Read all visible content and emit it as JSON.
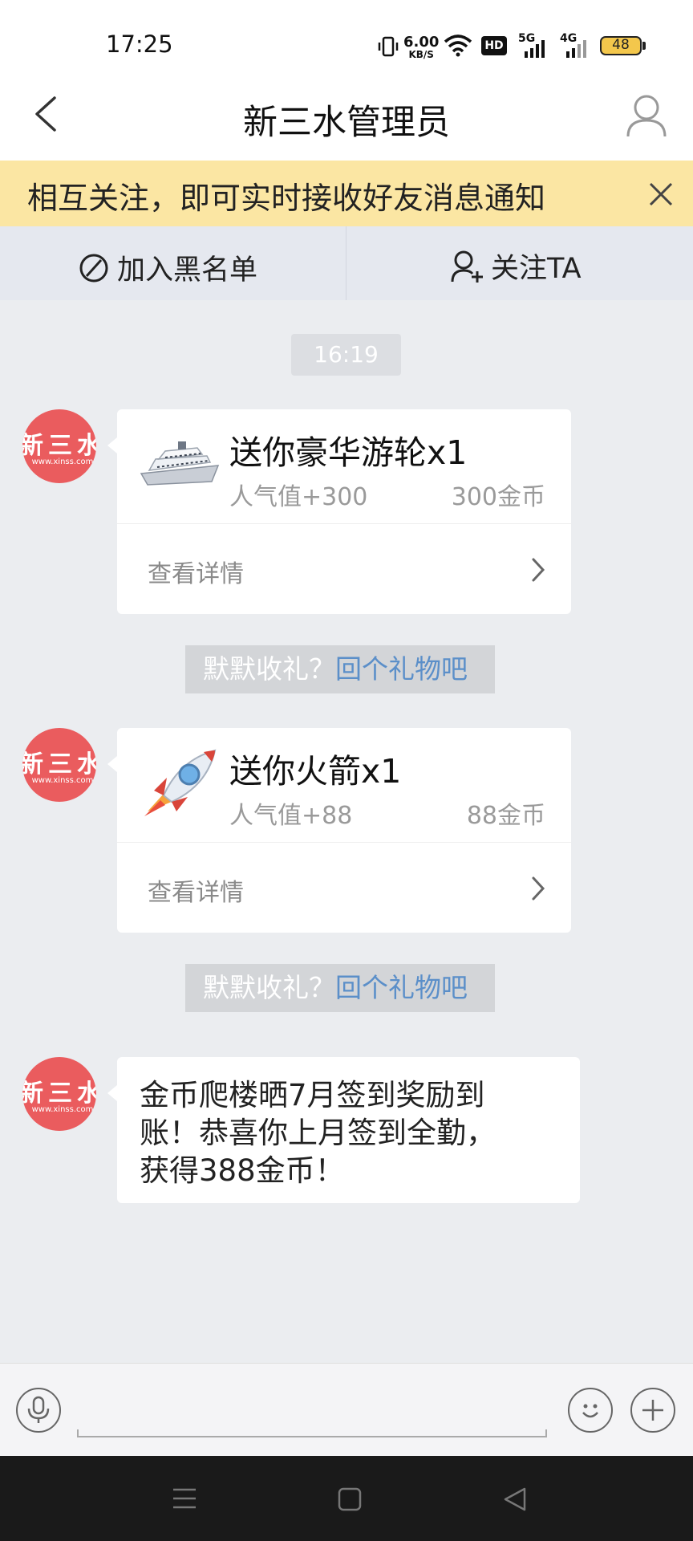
{
  "status_bar": {
    "time": "17:25",
    "net_speed_value": "6.00",
    "net_speed_unit": "KB/S",
    "hd_badge": "HD",
    "signal_1": "5G",
    "signal_2": "4G",
    "battery": "48",
    "battery_color": "#f3c74c",
    "icons": [
      "vibrate-icon",
      "wifi-icon",
      "hd-icon",
      "signal-5g-icon",
      "signal-4g-icon",
      "battery-icon"
    ]
  },
  "header": {
    "title": "新三水管理员",
    "back_icon": "chevron-left-icon",
    "profile_icon": "user-icon"
  },
  "notice": {
    "text": "相互关注，即可实时接收好友消息通知",
    "close_icon": "close-icon",
    "background": "#fbe6a3"
  },
  "actions": {
    "blacklist_label": "加入黑名单",
    "follow_label": "关注TA"
  },
  "chat": {
    "time_label": "16:19",
    "avatar": {
      "text_main": "新三水",
      "text_url": "www.xinss.com",
      "color": "#ea5c5e"
    },
    "messages": [
      {
        "type": "gift",
        "title": "送你豪华游轮x1",
        "popularity": "人气值+300",
        "coins": "300金币",
        "detail_label": "查看详情",
        "icon": "cruise-ship-icon"
      },
      {
        "type": "gift",
        "title": "送你火箭x1",
        "popularity": "人气值+88",
        "coins": "88金币",
        "detail_label": "查看详情",
        "icon": "rocket-icon"
      },
      {
        "type": "text",
        "line1": "金币爬楼晒7月签到奖励到",
        "line2": "账！恭喜你上月签到全勤，",
        "line3": "获得388金币！"
      }
    ],
    "reply_prompt": {
      "text": "默默收礼？",
      "link": "回个礼物吧",
      "link_color": "#5b8fc9"
    }
  },
  "input_bar": {
    "icons": [
      "microphone-icon",
      "emoji-icon",
      "plus-icon"
    ]
  },
  "nav_bar": {
    "icons": [
      "menu-icon",
      "home-icon",
      "back-triangle-icon"
    ]
  }
}
